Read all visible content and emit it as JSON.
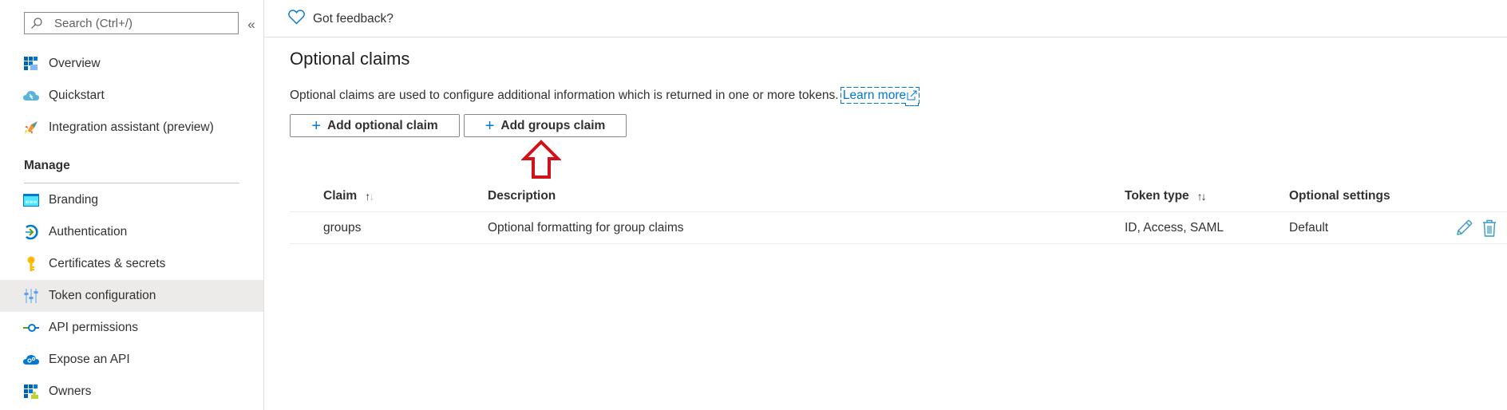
{
  "sidebar": {
    "search": {
      "placeholder": "Search (Ctrl+/)",
      "value": ""
    },
    "collapse_label": "«",
    "items": [
      {
        "label": "Overview",
        "icon": "overview-grid-icon"
      },
      {
        "label": "Quickstart",
        "icon": "quickstart-cloud-icon"
      },
      {
        "label": "Integration assistant (preview)",
        "icon": "rocket-icon"
      }
    ],
    "manage": {
      "title": "Manage",
      "items": [
        {
          "label": "Branding",
          "icon": "branding-www-icon"
        },
        {
          "label": "Authentication",
          "icon": "authentication-icon"
        },
        {
          "label": "Certificates & secrets",
          "icon": "key-icon"
        },
        {
          "label": "Token configuration",
          "icon": "token-sliders-icon",
          "selected": true
        },
        {
          "label": "API permissions",
          "icon": "api-permissions-icon"
        },
        {
          "label": "Expose an API",
          "icon": "expose-api-cloud-icon"
        },
        {
          "label": "Owners",
          "icon": "owners-icon"
        }
      ]
    }
  },
  "topbar": {
    "feedback_label": "Got feedback?"
  },
  "main": {
    "title": "Optional claims",
    "description": "Optional claims are used to configure additional information which is returned in one or more tokens.",
    "learn_more": "Learn more",
    "buttons": {
      "add_optional": "Add optional claim",
      "add_groups": "Add groups claim"
    },
    "table": {
      "columns": {
        "claim": "Claim",
        "description": "Description",
        "token_type": "Token type",
        "optional_settings": "Optional settings"
      },
      "rows": [
        {
          "claim": "groups",
          "description": "Optional formatting for group claims",
          "token_type": "ID, Access, SAML",
          "optional_settings": "Default"
        }
      ]
    }
  },
  "colors": {
    "accent": "#0078d4",
    "annotation_arrow": "#d0121b",
    "selected_bg": "#edebe9"
  }
}
